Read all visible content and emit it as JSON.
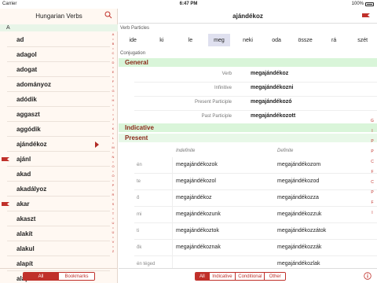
{
  "status_bar": {
    "carrier": "Carrier",
    "time": "6:47 PM",
    "battery": "100%"
  },
  "sidebar": {
    "title": "Hungarian Verbs",
    "section_letter": "A",
    "verbs": [
      {
        "name": "ad",
        "flag": false,
        "selected": false
      },
      {
        "name": "adagol",
        "flag": false,
        "selected": false
      },
      {
        "name": "adogat",
        "flag": false,
        "selected": false
      },
      {
        "name": "adományoz",
        "flag": false,
        "selected": false
      },
      {
        "name": "adódik",
        "flag": false,
        "selected": false
      },
      {
        "name": "aggaszt",
        "flag": false,
        "selected": false
      },
      {
        "name": "aggódik",
        "flag": false,
        "selected": false
      },
      {
        "name": "ajándékoz",
        "flag": false,
        "selected": true
      },
      {
        "name": "ajánl",
        "flag": true,
        "selected": false
      },
      {
        "name": "akad",
        "flag": false,
        "selected": false
      },
      {
        "name": "akadályoz",
        "flag": false,
        "selected": false
      },
      {
        "name": "akar",
        "flag": true,
        "selected": false
      },
      {
        "name": "akaszt",
        "flag": false,
        "selected": false
      },
      {
        "name": "alakít",
        "flag": false,
        "selected": false
      },
      {
        "name": "alakul",
        "flag": false,
        "selected": false
      },
      {
        "name": "alapít",
        "flag": false,
        "selected": false
      },
      {
        "name": "alapoz",
        "flag": false,
        "selected": false
      }
    ],
    "index_letters": [
      "A",
      "•",
      "B",
      "•",
      "C",
      "•",
      "D",
      "•",
      "E",
      "•",
      "F",
      "•",
      "G",
      "•",
      "H",
      "•",
      "I",
      "•",
      "J",
      "•",
      "K",
      "•",
      "L",
      "•",
      "M",
      "•",
      "N",
      "•",
      "O",
      "•",
      "Ö",
      "•",
      "P",
      "•",
      "R",
      "•",
      "S",
      "•",
      "T",
      "•",
      "U",
      "•",
      "Ü",
      "•",
      "V",
      "•",
      "Z"
    ],
    "filter": {
      "all": "All",
      "bookmarks": "Bookmarks"
    }
  },
  "main": {
    "title": "ajándékoz",
    "particles_label": "Verb Particles",
    "particles": [
      "ide",
      "ki",
      "le",
      "meg",
      "neki",
      "oda",
      "össze",
      "rá",
      "szét"
    ],
    "selected_particle": "meg",
    "conjugation_label": "Conjugation",
    "general_title": "General",
    "general": [
      {
        "label": "Verb",
        "value": "megajándékoz"
      },
      {
        "label": "Infinitive",
        "value": "megajándékozni"
      },
      {
        "label": "Present Participle",
        "value": "megajándékozó"
      },
      {
        "label": "Past Participle",
        "value": "megajándékozott"
      }
    ],
    "indicative_title": "Indicative",
    "present_title": "Present",
    "col_indefinite": "Indefinite",
    "col_definite": "Definite",
    "present": [
      {
        "pronoun": "én",
        "indefinite": "megajándékozok",
        "definite": "megajándékozom"
      },
      {
        "pronoun": "te",
        "indefinite": "megajándékozol",
        "definite": "megajándékozod"
      },
      {
        "pronoun": "ő",
        "indefinite": "megajándékoz",
        "definite": "megajándékozza"
      },
      {
        "pronoun": "mi",
        "indefinite": "megajándékozunk",
        "definite": "megajándékozzuk"
      },
      {
        "pronoun": "ti",
        "indefinite": "megajándékoztok",
        "definite": "megajándékozzátok"
      },
      {
        "pronoun": "ők",
        "indefinite": "megajándékoznak",
        "definite": "megajándékozzák"
      },
      {
        "pronoun": "én téged",
        "indefinite": "",
        "definite": "megajándékozlak"
      }
    ],
    "index_letters": [
      "G",
      "I",
      "P",
      "P",
      "C",
      "F",
      "C",
      "P",
      "F",
      "I"
    ],
    "tabs": {
      "all": "All",
      "indicative": "Indicative",
      "conditional": "Conditional",
      "other": "Other"
    }
  },
  "colors": {
    "accent": "#c0302a",
    "section_green": "#d9f5d9",
    "sidebar_bg": "#fff8f2"
  },
  "icons": {
    "search": "search-icon",
    "flag": "flag-icon",
    "info": "info-icon"
  }
}
